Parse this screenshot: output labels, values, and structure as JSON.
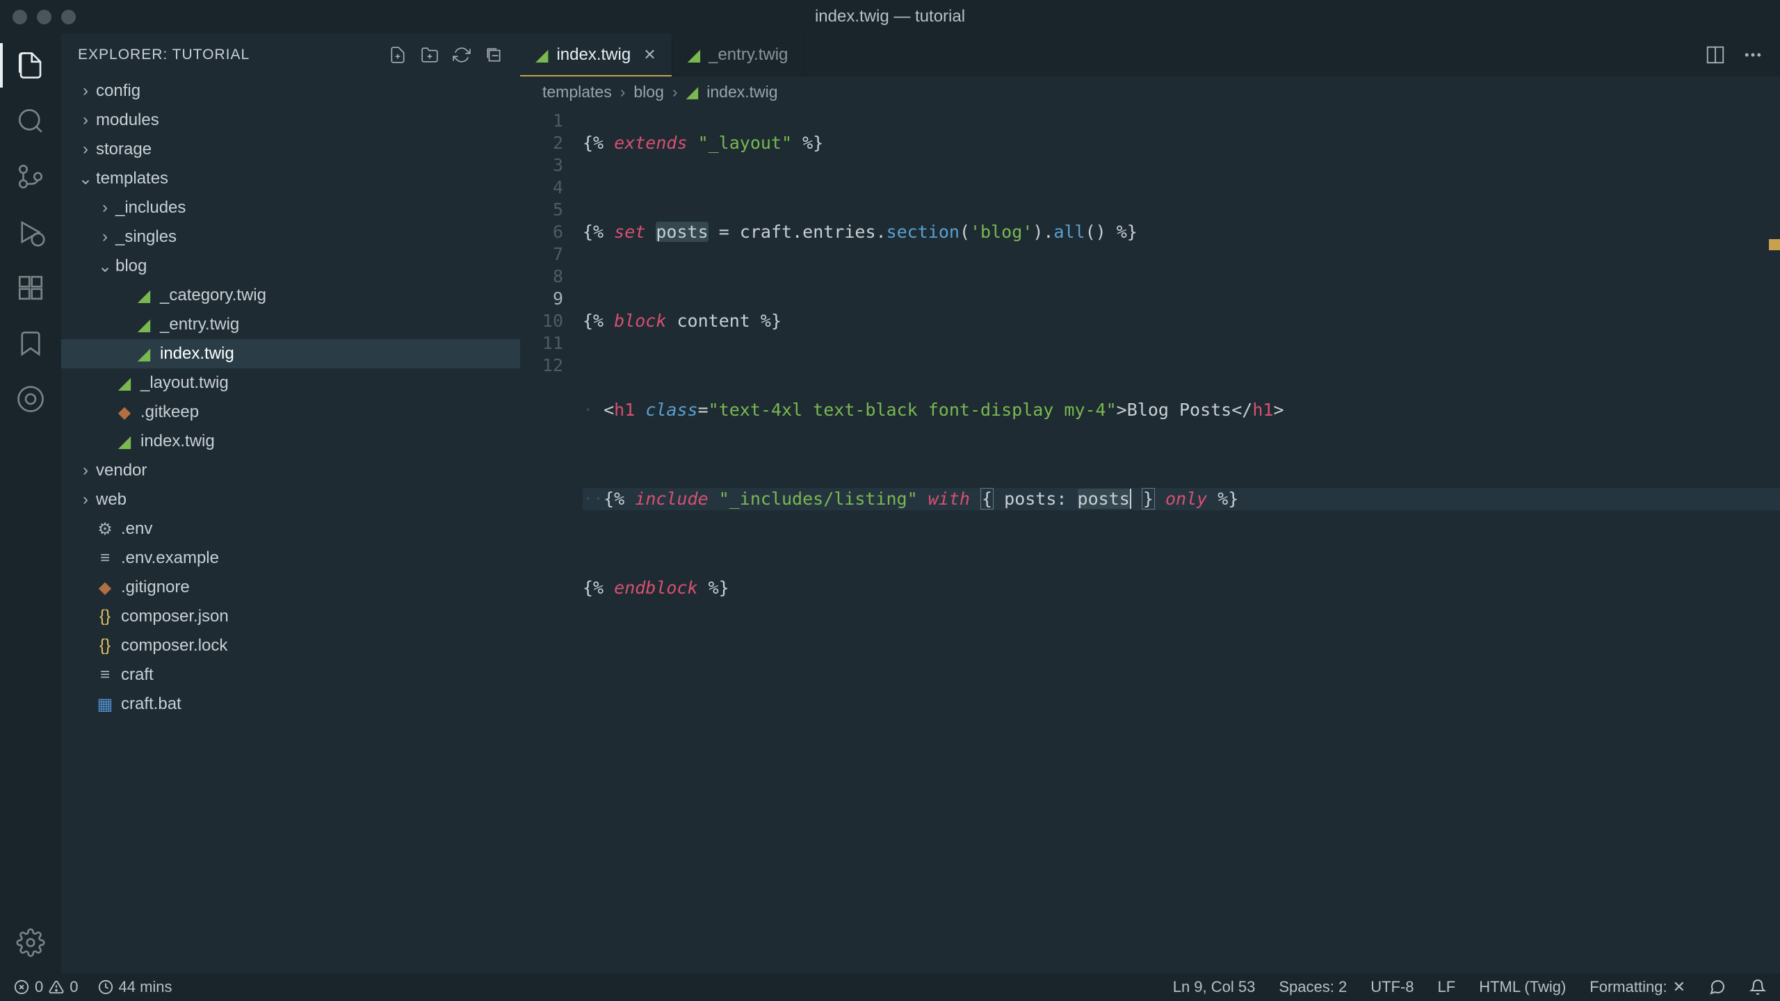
{
  "window": {
    "title": "index.twig — tutorial"
  },
  "explorer": {
    "title": "EXPLORER: TUTORIAL",
    "tree": [
      {
        "name": "config",
        "kind": "folder",
        "depth": 0,
        "expanded": false
      },
      {
        "name": "modules",
        "kind": "folder",
        "depth": 0,
        "expanded": false
      },
      {
        "name": "storage",
        "kind": "folder",
        "depth": 0,
        "expanded": false
      },
      {
        "name": "templates",
        "kind": "folder",
        "depth": 0,
        "expanded": true
      },
      {
        "name": "_includes",
        "kind": "folder",
        "depth": 1,
        "expanded": false
      },
      {
        "name": "_singles",
        "kind": "folder",
        "depth": 1,
        "expanded": false
      },
      {
        "name": "blog",
        "kind": "folder",
        "depth": 1,
        "expanded": true
      },
      {
        "name": "_category.twig",
        "kind": "twig",
        "depth": 2
      },
      {
        "name": "_entry.twig",
        "kind": "twig",
        "depth": 2
      },
      {
        "name": "index.twig",
        "kind": "twig",
        "depth": 2,
        "selected": true
      },
      {
        "name": "_layout.twig",
        "kind": "twig",
        "depth": 1
      },
      {
        "name": ".gitkeep",
        "kind": "git",
        "depth": 1
      },
      {
        "name": "index.twig",
        "kind": "twig",
        "depth": 1
      },
      {
        "name": "vendor",
        "kind": "folder",
        "depth": 0,
        "expanded": false
      },
      {
        "name": "web",
        "kind": "folder",
        "depth": 0,
        "expanded": false
      },
      {
        "name": ".env",
        "kind": "gear",
        "depth": 0
      },
      {
        "name": ".env.example",
        "kind": "file",
        "depth": 0
      },
      {
        "name": ".gitignore",
        "kind": "git",
        "depth": 0
      },
      {
        "name": "composer.json",
        "kind": "json",
        "depth": 0
      },
      {
        "name": "composer.lock",
        "kind": "json",
        "depth": 0
      },
      {
        "name": "craft",
        "kind": "file",
        "depth": 0
      },
      {
        "name": "craft.bat",
        "kind": "bat",
        "depth": 0
      }
    ]
  },
  "tabs": [
    {
      "label": "index.twig",
      "active": true,
      "closeable": true
    },
    {
      "label": "_entry.twig",
      "active": false,
      "closeable": false
    }
  ],
  "breadcrumb": {
    "seg1": "templates",
    "seg2": "blog",
    "seg3": "index.twig"
  },
  "code": {
    "line_numbers": [
      "1",
      "2",
      "3",
      "4",
      "5",
      "6",
      "7",
      "8",
      "9",
      "10",
      "11",
      "12"
    ],
    "active_line": 9,
    "lines": {
      "l1_extends": "extends",
      "l1_str": "\"_layout\"",
      "l3_set": "set",
      "l3_posts": "posts",
      "l3_eq": "=",
      "l3_craft": "craft",
      "l3_entries": "entries",
      "l3_section": "section",
      "l3_arg": "'blog'",
      "l3_all": "all",
      "l5_block": "block",
      "l5_content": "content",
      "l7_tag": "h1",
      "l7_attr": "class",
      "l7_val": "\"text-4xl text-black font-display my-4\"",
      "l7_text": "Blog Posts",
      "l9_include": "include",
      "l9_path": "\"_includes/listing\"",
      "l9_with": "with",
      "l9_key": "posts",
      "l9_val": "posts",
      "l9_only": "only",
      "l11_endblock": "endblock"
    }
  },
  "status": {
    "errors": "0",
    "warnings": "0",
    "time": "44 mins",
    "position": "Ln 9, Col 53",
    "spaces": "Spaces: 2",
    "encoding": "UTF-8",
    "eol": "LF",
    "language": "HTML (Twig)",
    "formatting": "Formatting:"
  }
}
